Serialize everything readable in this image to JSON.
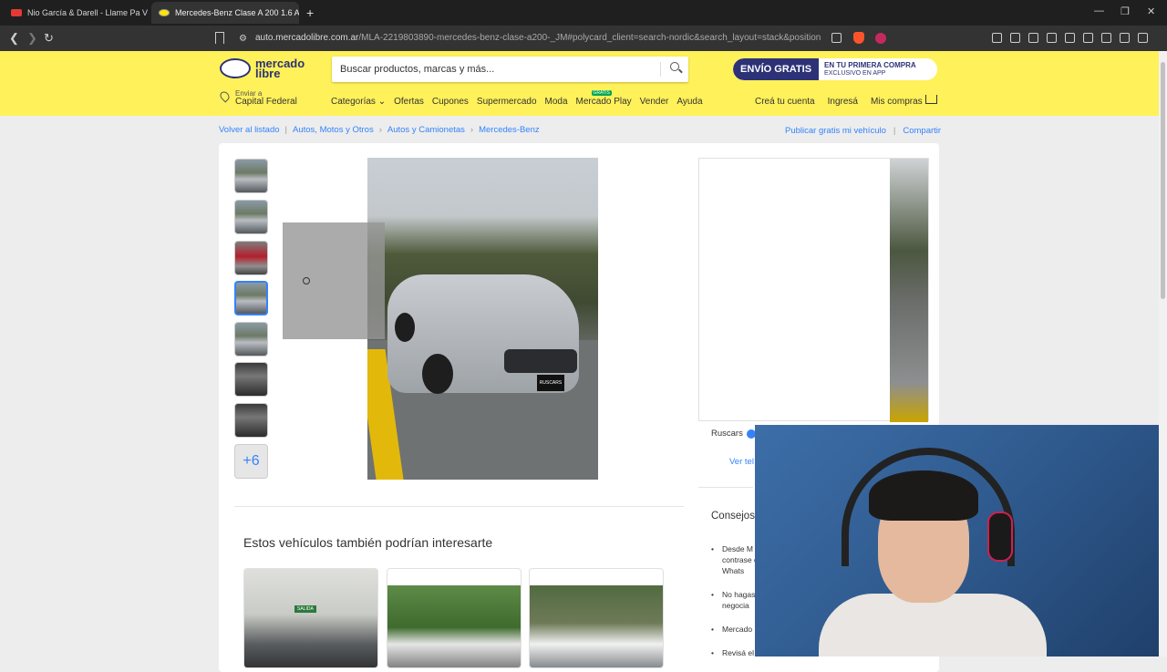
{
  "browser": {
    "tabs": [
      {
        "title": "Nio García & Darell - Llame Pa Ve"
      },
      {
        "title": "Mercedes-Benz Clase A 200 1.6 A"
      }
    ],
    "url_host": "auto.mercadolibre.com.ar",
    "url_path": "/MLA-2219803890-mercedes-benz-clase-a200-_JM#polycard_client=search-nordic&search_layout=stack&position=4&typ..."
  },
  "header": {
    "logo_line1": "mercado",
    "logo_line2": "libre",
    "search_placeholder": "Buscar productos, marcas y más...",
    "promo_badge": "ENVÍO GRATIS",
    "promo_line1": "EN TU PRIMERA COMPRA",
    "promo_line2": "EXCLUSIVO EN APP",
    "deliver_label": "Enviar a",
    "deliver_city": "Capital Federal",
    "nav": [
      "Categorías",
      "Ofertas",
      "Cupones",
      "Supermercado",
      "Moda",
      "Mercado Play",
      "Vender",
      "Ayuda"
    ],
    "gratis_tag": "GRATIS",
    "right_nav": [
      "Creá tu cuenta",
      "Ingresá",
      "Mis compras"
    ]
  },
  "breadcrumb": {
    "back": "Volver al listado",
    "items": [
      "Autos, Motos y Otros",
      "Autos y Camionetas",
      "Mercedes-Benz"
    ],
    "publish": "Publicar gratis mi vehículo",
    "share": "Compartir"
  },
  "gallery": {
    "more_label": "+6",
    "plate_text": "RUSCARS"
  },
  "seller": {
    "name": "Ruscars",
    "phone_link": "Ver tel"
  },
  "tips": {
    "title": "Consejos",
    "items": [
      "Desde M contrase de Whats",
      "No hagas negocia",
      "Mercado",
      "Revisá el"
    ]
  },
  "also": {
    "title": "Estos vehículos también podrían interesarte",
    "sign_text": "SALIDA"
  }
}
